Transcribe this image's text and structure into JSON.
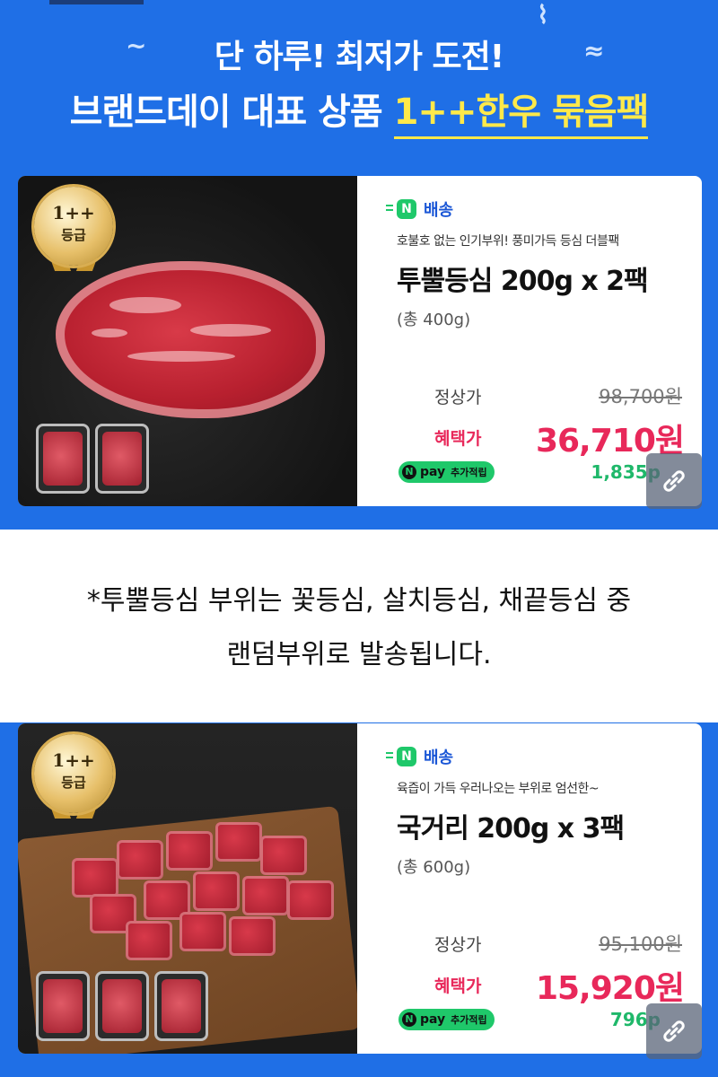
{
  "banner": {
    "headline": "단 하루! 최저가 도전!",
    "subhead_prefix": "브랜드데이 대표 상품 ",
    "subhead_highlight": "1++한우 묶음팩",
    "bg_color": "#1f6fe6",
    "highlight_color": "#ffe94a"
  },
  "grade_badge": {
    "grade": "1++",
    "label": "등급"
  },
  "shipping_label": "배송",
  "npay": {
    "logo": "N",
    "pay": "pay",
    "label": "추가적립"
  },
  "products": [
    {
      "desc": "호불호 없는 인기부위! 풍미가득 등심 더블팩",
      "name": "투뿔등심 200g x 2팩",
      "total": "(총 400g)",
      "regular_label": "정상가",
      "regular_price": "98,700원",
      "benefit_label": "혜택가",
      "benefit_price": "36,710원",
      "points": "1,835p"
    },
    {
      "desc": "육즙이 가득 우러나오는 부위로 엄선한~",
      "name": "국거리 200g x 3팩",
      "total": "(총 600g)",
      "regular_label": "정상가",
      "regular_price": "95,100원",
      "benefit_label": "혜택가",
      "benefit_price": "15,920원",
      "points": "796p"
    }
  ],
  "notice": {
    "line1": "*투뿔등심 부위는 꽃등심, 살치등심, 채끝등심 중",
    "line2": "랜덤부위로 발송됩니다."
  },
  "icons": {
    "link": "link-icon",
    "delivery": "delivery-n-icon"
  }
}
